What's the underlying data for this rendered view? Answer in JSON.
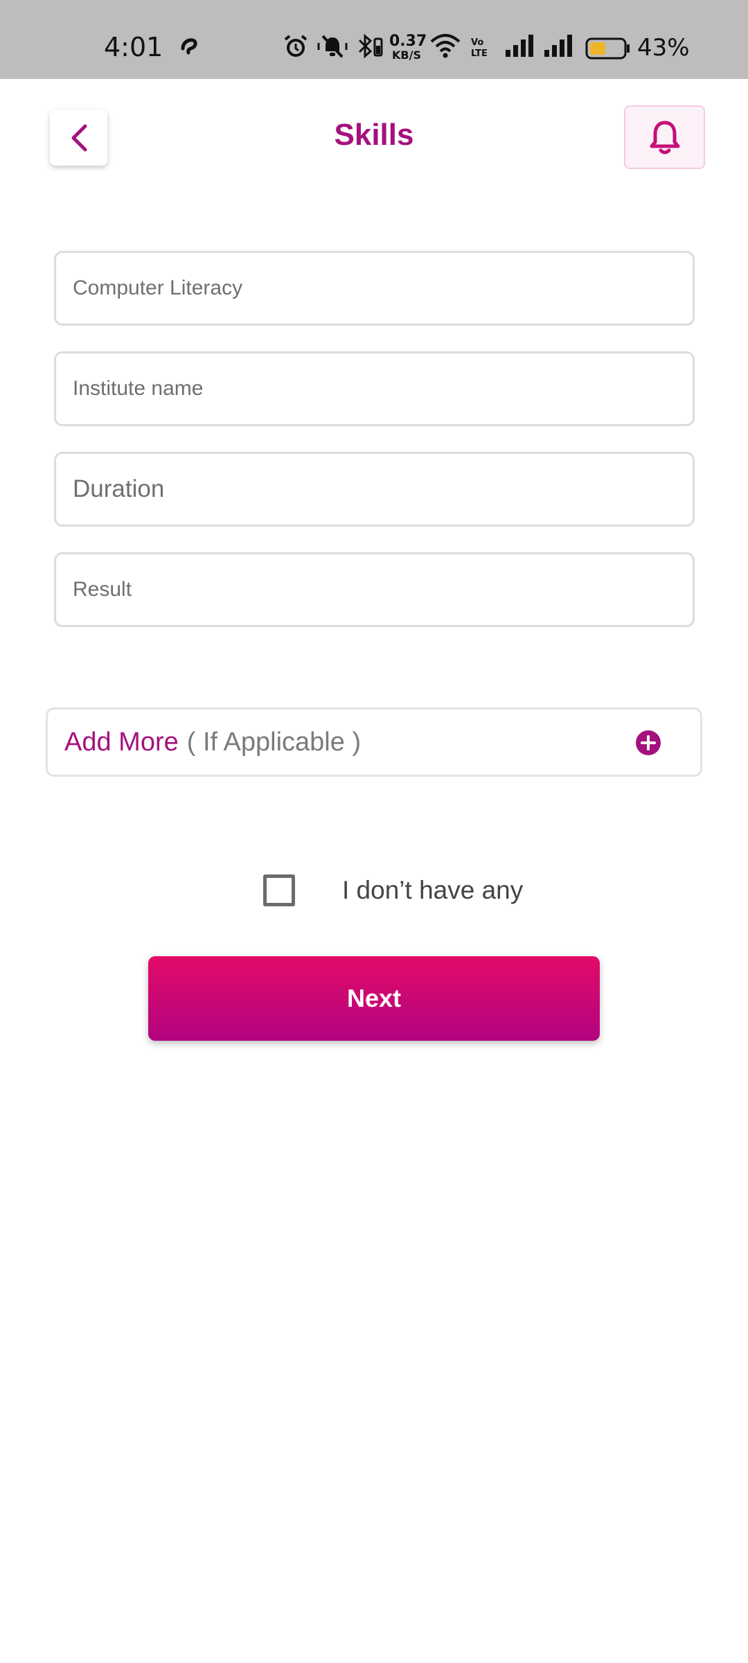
{
  "status_bar": {
    "time": "4:01",
    "net_speed_value": "0.37",
    "net_speed_unit": "KB/S",
    "battery_pct": "43%",
    "icons": [
      "alarm-icon",
      "muted-bell-icon",
      "bluetooth-battery-icon",
      "wifi-icon",
      "volte-icon",
      "signal-icon",
      "signal-icon",
      "battery-icon"
    ]
  },
  "header": {
    "title": "Skills",
    "back_icon": "chevron-left-icon",
    "notification_icon": "bell-icon"
  },
  "form": {
    "fields": [
      {
        "placeholder": "Computer Literacy",
        "value": ""
      },
      {
        "placeholder": "Institute name",
        "value": ""
      },
      {
        "placeholder": "Duration",
        "value": ""
      },
      {
        "placeholder": "Result",
        "value": ""
      }
    ]
  },
  "add_more": {
    "label": "Add More",
    "hint": "( If Applicable )",
    "icon": "plus-circle-icon"
  },
  "no_skills": {
    "label": "I don’t have any",
    "checked": false
  },
  "next_button": {
    "label": "Next"
  },
  "colors": {
    "accent": "#a4117e",
    "button_gradient_top": "#e30b68",
    "button_gradient_bottom": "#b1047f",
    "status_bar_bg": "#bdbdbd",
    "border": "#dcdcdc"
  }
}
